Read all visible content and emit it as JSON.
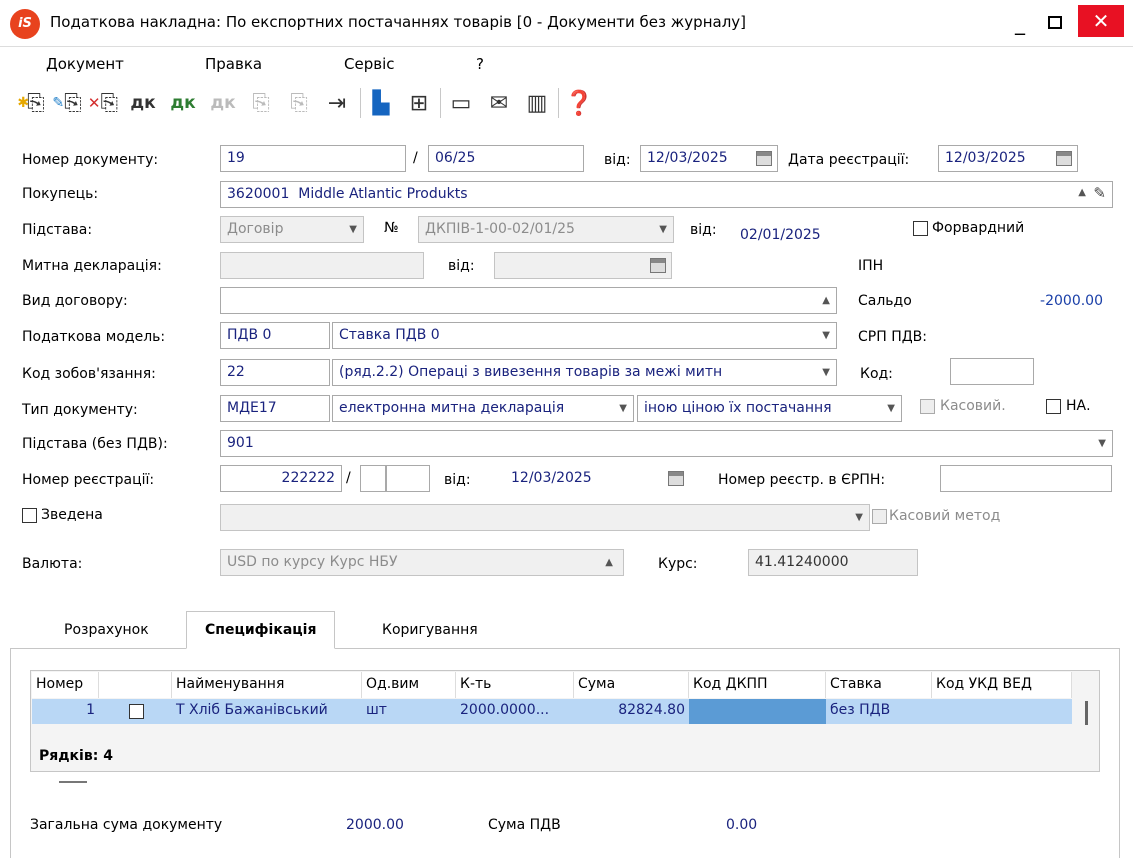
{
  "window": {
    "title": "Податкова накладна: По експортних  постачаннях товарів [0 - Документи без журналу]",
    "logo_text": "iS"
  },
  "menu": [
    "Документ",
    "Правка",
    "Сервіс",
    "?"
  ],
  "form": {
    "doc_number_label": "Номер документу:",
    "doc_number": "19",
    "doc_number_slash": "/",
    "doc_suffix": "06/25",
    "doc_from_label": "від:",
    "doc_date": "12/03/2025",
    "reg_date_label": "Дата реєстрації:",
    "reg_date": "12/03/2025",
    "buyer_label": "Покупець:",
    "buyer_code": "3620001",
    "buyer_name": "Middle Atlantic Produkts",
    "basis_label": "Підстава:",
    "basis_value": "Договір",
    "basis_no_label": "№",
    "basis_no": "ДКПІВ-1-00-02/01/25",
    "basis_from_label": "від:",
    "basis_date": "02/01/2025",
    "forward_label": "Форвардний",
    "customs_label": "Митна декларація:",
    "customs_from_label": "від:",
    "ipn_label": "ІПН",
    "contract_type_label": "Вид договору:",
    "saldo_label": "Сальдо",
    "saldo_value": "-2000.00",
    "tax_model_label": "Податкова модель:",
    "tax_model_code": "ПДВ  0",
    "tax_model_name": "Ставка ПДВ 0",
    "srp_label": "СРП ПДВ:",
    "obligation_label": "Код зобов'язання:",
    "obligation_code": "22",
    "obligation_name": "(ряд.2.2) Операці з вивезення товарів за межі митн",
    "code_label": "Код:",
    "doc_type_label": "Тип документу:",
    "doc_type_code": "МДЕ17",
    "doc_type_name": "електронна митна декларація",
    "doc_type_extra": "іною ціною їх постачання",
    "cash_label": "Касовий.",
    "na_label": "НА.",
    "basis_novat_label": "Підстава (без ПДВ):",
    "basis_novat_value": "901",
    "reg_number_label": "Номер реєстрації:",
    "reg_number": "222222",
    "reg_number_slash": "/",
    "reg_from_label": "від:",
    "reg_from_date": "12/03/2025",
    "erpn_label": "Номер реєстр. в ЄРПН:",
    "summary_label": "Зведена",
    "cash_method_label": "Касовий метод",
    "currency_label": "Валюта:",
    "currency_value": "USD по курсу Курс НБУ",
    "rate_label": "Курс:",
    "rate_value": "41.41240000"
  },
  "tabs": [
    "Розрахунок",
    "Специфікація",
    "Коригування"
  ],
  "grid": {
    "columns": [
      "Номер",
      "",
      "Найменування",
      "Од.вим",
      "К-ть",
      "Сума",
      "Код ДКПП",
      "Ставка",
      "Код УКД ВЕД"
    ],
    "row": {
      "number": "1",
      "name": "Т Хліб Бажанівський",
      "unit": "шт",
      "qty": "2000.0000...",
      "sum": "82824.80",
      "dkpp": "",
      "rate": "без ПДВ",
      "ukd": ""
    },
    "rows_label": "Рядків: 4"
  },
  "footer": {
    "total_label": "Загальна сума документу",
    "total_value": "2000.00",
    "vat_label": "Сума ПДВ",
    "vat_value": "0.00"
  },
  "colors": {
    "accent": "#1a237e",
    "selection": "#b9d7f5",
    "close": "#e81123"
  }
}
